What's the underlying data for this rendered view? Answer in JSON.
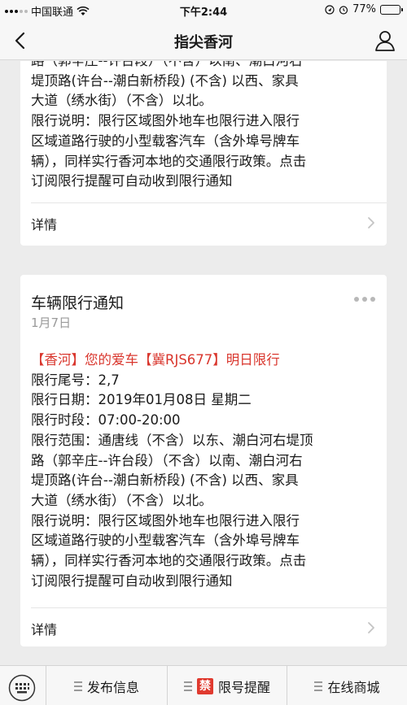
{
  "status_bar": {
    "carrier": "中国联通",
    "time": "下午2:44",
    "battery_text": "77%",
    "battery_level": 0.77
  },
  "nav": {
    "title": "指尖香河",
    "back_icon": "chevron-left-icon",
    "user_icon": "person-icon"
  },
  "cards": [
    {
      "body_lines": [
        "路（郭辛庄--许台段）（不含）以南、潮白河右",
        "堤顶路(许台--潮白新桥段) (不含) 以西、家具",
        "大道（绣水街）（不含）以北。",
        "限行说明：限行区域图外地车也限行进入限行",
        "区域道路行驶的小型载客汽车（含外埠号牌车",
        "辆），同样实行香河本地的交通限行政策。点击",
        "订阅限行提醒可自动收到限行通知"
      ],
      "detail_label": "详情"
    },
    {
      "title": "车辆限行通知",
      "date": "1月7日",
      "headline": "【香河】您的爱车【冀RJS677】明日限行",
      "body_lines": [
        "限行尾号：2,7",
        "限行日期：2019年01月08日 星期二",
        "限行时段：07:00-20:00",
        "限行范围：通唐线（不含）以东、潮白河右堤顶",
        "路（郭辛庄--许台段）（不含）以南、潮白河右",
        "堤顶路(许台--潮白新桥段) (不含) 以西、家具",
        "大道（绣水街）（不含）以北。",
        "限行说明：限行区域图外地车也限行进入限行",
        "区域道路行驶的小型载客汽车（含外埠号牌车",
        "辆），同样实行香河本地的交通限行政策。点击",
        "订阅限行提醒可自动收到限行通知"
      ],
      "detail_label": "详情"
    }
  ],
  "bottom_menu": {
    "items": [
      {
        "label": "发布信息"
      },
      {
        "label": "限号提醒",
        "badge": "禁"
      },
      {
        "label": "在线商城"
      }
    ]
  },
  "colors": {
    "accent_red": "#d9362d",
    "background": "#ececec"
  }
}
